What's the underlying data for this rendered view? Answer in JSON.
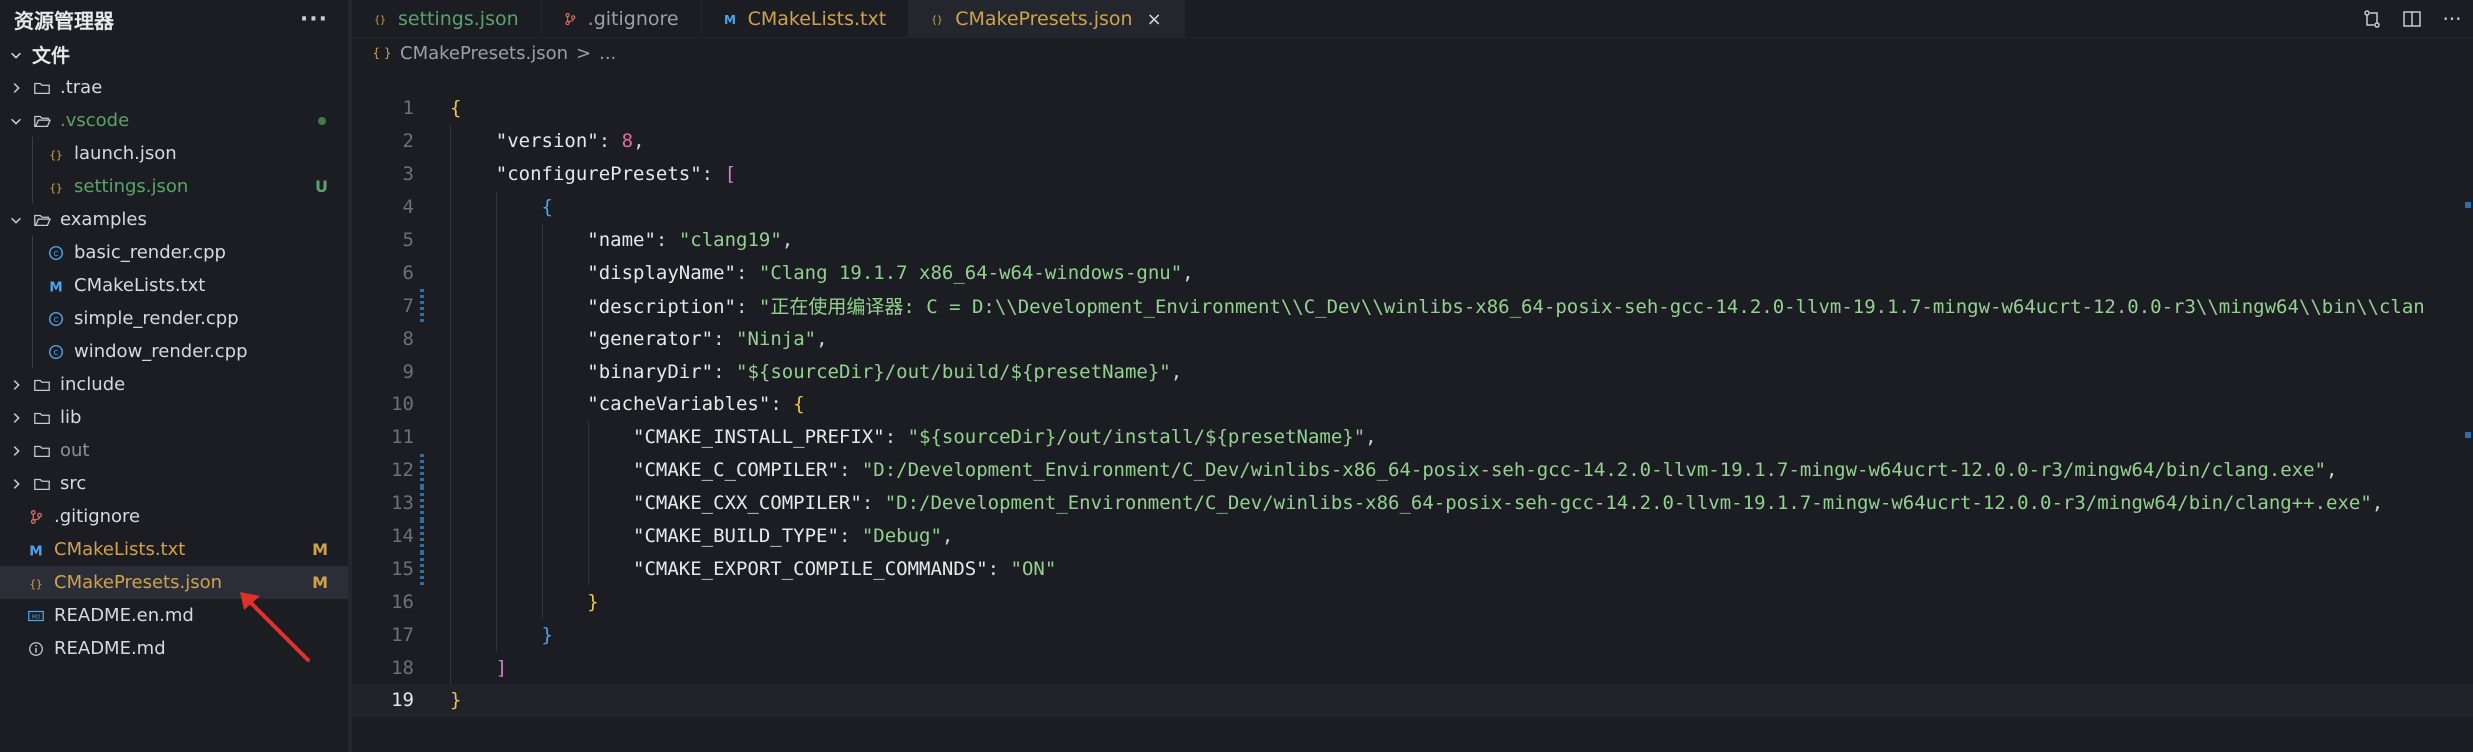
{
  "sidebar": {
    "title": "资源管理器",
    "more": "···",
    "root": "文件",
    "items": [
      {
        "label": ".trae",
        "type": "folder",
        "indent": 1,
        "open": false,
        "color": "#d6d9de"
      },
      {
        "label": ".vscode",
        "type": "folder",
        "indent": 1,
        "open": true,
        "color": "#5aa36a",
        "dot": true
      },
      {
        "label": "launch.json",
        "type": "json",
        "indent": 2,
        "color": "#d6d9de"
      },
      {
        "label": "settings.json",
        "type": "json",
        "indent": 2,
        "color": "#5aa36a",
        "badge": "U"
      },
      {
        "label": "examples",
        "type": "folder",
        "indent": 1,
        "open": true,
        "color": "#d6d9de"
      },
      {
        "label": "basic_render.cpp",
        "type": "cpp",
        "indent": 2,
        "color": "#d6d9de"
      },
      {
        "label": "CMakeLists.txt",
        "type": "cmake",
        "indent": 2,
        "color": "#d6d9de"
      },
      {
        "label": "simple_render.cpp",
        "type": "cpp",
        "indent": 2,
        "color": "#d6d9de"
      },
      {
        "label": "window_render.cpp",
        "type": "cpp",
        "indent": 2,
        "color": "#d6d9de"
      },
      {
        "label": "include",
        "type": "folder",
        "indent": 1,
        "open": false,
        "color": "#d6d9de"
      },
      {
        "label": "lib",
        "type": "folder",
        "indent": 1,
        "open": false,
        "color": "#d6d9de"
      },
      {
        "label": "out",
        "type": "folder",
        "indent": 1,
        "open": false,
        "color": "#8a9099"
      },
      {
        "label": "src",
        "type": "folder",
        "indent": 1,
        "open": false,
        "color": "#d6d9de"
      },
      {
        "label": ".gitignore",
        "type": "git",
        "indent": 1,
        "color": "#d6d9de"
      },
      {
        "label": "CMakeLists.txt",
        "type": "cmake",
        "indent": 1,
        "color": "#d0a24a",
        "badge": "M"
      },
      {
        "label": "CMakePresets.json",
        "type": "json",
        "indent": 1,
        "color": "#d0a24a",
        "badge": "M",
        "selected": true
      },
      {
        "label": "README.en.md",
        "type": "md",
        "indent": 1,
        "color": "#d6d9de"
      },
      {
        "label": "README.md",
        "type": "info",
        "indent": 1,
        "color": "#d6d9de"
      }
    ]
  },
  "tabs": [
    {
      "label": "settings.json",
      "type": "json",
      "color": "#5aa36a"
    },
    {
      "label": ".gitignore",
      "type": "git",
      "color": "#9aa0a8"
    },
    {
      "label": "CMakeLists.txt",
      "type": "cmake",
      "color": "#d0a24a"
    },
    {
      "label": "CMakePresets.json",
      "type": "json",
      "color": "#d0a24a",
      "active": true,
      "close": "×"
    }
  ],
  "breadcrumb": {
    "file": "CMakePresets.json",
    "sep": ">",
    "rest": "..."
  },
  "code": {
    "current_line": 19,
    "modified_lines": [
      7,
      12,
      13,
      14,
      15
    ],
    "lines": [
      [
        [
          "b1",
          "{"
        ]
      ],
      [
        [
          "p",
          "    "
        ],
        [
          "k",
          "\"version\""
        ],
        [
          "p",
          ": "
        ],
        [
          "n",
          "8"
        ],
        [
          "p",
          ","
        ]
      ],
      [
        [
          "p",
          "    "
        ],
        [
          "k",
          "\"configurePresets\""
        ],
        [
          "p",
          ": "
        ],
        [
          "b2",
          "["
        ]
      ],
      [
        [
          "p",
          "        "
        ],
        [
          "b3",
          "{"
        ]
      ],
      [
        [
          "p",
          "            "
        ],
        [
          "k",
          "\"name\""
        ],
        [
          "p",
          ": "
        ],
        [
          "s",
          "\"clang19\""
        ],
        [
          "p",
          ","
        ]
      ],
      [
        [
          "p",
          "            "
        ],
        [
          "k",
          "\"displayName\""
        ],
        [
          "p",
          ": "
        ],
        [
          "s",
          "\"Clang 19.1.7 x86_64-w64-windows-gnu\""
        ],
        [
          "p",
          ","
        ]
      ],
      [
        [
          "p",
          "            "
        ],
        [
          "k",
          "\"description\""
        ],
        [
          "p",
          ": "
        ],
        [
          "s",
          "\"正在使用编译器: C = D:\\\\Development_Environment\\\\C_Dev\\\\winlibs-x86_64-posix-seh-gcc-14.2.0-llvm-19.1.7-mingw-w64ucrt-12.0.0-r3\\\\mingw64\\\\bin\\\\clan"
        ]
      ],
      [
        [
          "p",
          "            "
        ],
        [
          "k",
          "\"generator\""
        ],
        [
          "p",
          ": "
        ],
        [
          "s",
          "\"Ninja\""
        ],
        [
          "p",
          ","
        ]
      ],
      [
        [
          "p",
          "            "
        ],
        [
          "k",
          "\"binaryDir\""
        ],
        [
          "p",
          ": "
        ],
        [
          "s",
          "\"${sourceDir}/out/build/${presetName}\""
        ],
        [
          "p",
          ","
        ]
      ],
      [
        [
          "p",
          "            "
        ],
        [
          "k",
          "\"cacheVariables\""
        ],
        [
          "p",
          ": "
        ],
        [
          "b1",
          "{"
        ]
      ],
      [
        [
          "p",
          "                "
        ],
        [
          "k",
          "\"CMAKE_INSTALL_PREFIX\""
        ],
        [
          "p",
          ": "
        ],
        [
          "s",
          "\"${sourceDir}/out/install/${presetName}\""
        ],
        [
          "p",
          ","
        ]
      ],
      [
        [
          "p",
          "                "
        ],
        [
          "k",
          "\"CMAKE_C_COMPILER\""
        ],
        [
          "p",
          ": "
        ],
        [
          "s",
          "\"D:/Development_Environment/C_Dev/winlibs-x86_64-posix-seh-gcc-14.2.0-llvm-19.1.7-mingw-w64ucrt-12.0.0-r3/mingw64/bin/clang.exe\""
        ],
        [
          "p",
          ","
        ]
      ],
      [
        [
          "p",
          "                "
        ],
        [
          "k",
          "\"CMAKE_CXX_COMPILER\""
        ],
        [
          "p",
          ": "
        ],
        [
          "s",
          "\"D:/Development_Environment/C_Dev/winlibs-x86_64-posix-seh-gcc-14.2.0-llvm-19.1.7-mingw-w64ucrt-12.0.0-r3/mingw64/bin/clang++.exe\""
        ],
        [
          "p",
          ","
        ]
      ],
      [
        [
          "p",
          "                "
        ],
        [
          "k",
          "\"CMAKE_BUILD_TYPE\""
        ],
        [
          "p",
          ": "
        ],
        [
          "s",
          "\"Debug\""
        ],
        [
          "p",
          ","
        ]
      ],
      [
        [
          "p",
          "                "
        ],
        [
          "k",
          "\"CMAKE_EXPORT_COMPILE_COMMANDS\""
        ],
        [
          "p",
          ": "
        ],
        [
          "s",
          "\"ON\""
        ]
      ],
      [
        [
          "p",
          "            "
        ],
        [
          "b1",
          "}"
        ]
      ],
      [
        [
          "p",
          "        "
        ],
        [
          "b3",
          "}"
        ]
      ],
      [
        [
          "p",
          "    "
        ],
        [
          "b2",
          "]"
        ]
      ],
      [
        [
          "b1",
          "}"
        ]
      ]
    ]
  },
  "colors": {
    "accent": "#2f6fa3",
    "modified": "#d0a24a",
    "untracked": "#5aa36a",
    "annotation": "#e0302a"
  }
}
